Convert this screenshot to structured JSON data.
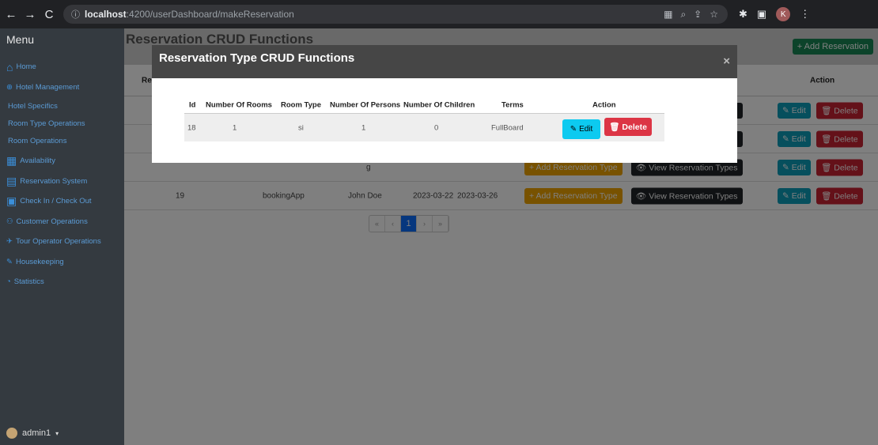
{
  "browser": {
    "url_host": "localhost",
    "url_path": ":4200/userDashboard/makeReservation",
    "profile_initial": "K"
  },
  "sidebar": {
    "title": "Menu",
    "items": [
      {
        "label": "Home",
        "icon": "home-icon"
      },
      {
        "label": "Hotel Management",
        "icon": "hotel-icon"
      },
      {
        "label": "Hotel Specifics",
        "icon": ""
      },
      {
        "label": "Room Type Operations",
        "icon": ""
      },
      {
        "label": "Room Operations",
        "icon": ""
      },
      {
        "label": "Availability",
        "icon": "calendar-icon"
      },
      {
        "label": "Reservation System",
        "icon": "reservation-icon"
      },
      {
        "label": "Check In / Check Out",
        "icon": "checkin-icon"
      },
      {
        "label": "Customer Operations",
        "icon": "users-icon"
      },
      {
        "label": "Tour Operator Operations",
        "icon": "plane-icon"
      },
      {
        "label": "Housekeeping",
        "icon": "broom-icon"
      },
      {
        "label": "Statistics",
        "icon": "chart-icon"
      }
    ],
    "user": "admin1"
  },
  "page": {
    "title": "Reservation CRUD Functions",
    "add_button": "+ Add Reservation",
    "table_header_action": "Action",
    "table_header_first": "Re",
    "row3_partial": "g",
    "row4": {
      "id": "19",
      "app": "bookingApp",
      "name": "John Doe",
      "start": "2023-03-22",
      "end": "2023-03-26"
    },
    "add_type_button": "+ Add Reservation Type",
    "view_types_button": "View Reservation Types",
    "edit_label": "Edit",
    "delete_label": "Delete",
    "pager": [
      "«",
      "‹",
      "1",
      "›",
      "»"
    ]
  },
  "modal": {
    "title": "Reservation Type CRUD Functions",
    "close": "×",
    "columns": [
      "Id",
      "Number Of Rooms",
      "Room Type",
      "Number Of Persons",
      "Number Of Children",
      "Terms",
      "Action"
    ],
    "row": {
      "id": "18",
      "rooms": "1",
      "room_type": "si",
      "persons": "1",
      "children": "0",
      "terms": "FullBoard"
    },
    "edit_label": "Edit",
    "delete_label": "Delete"
  }
}
